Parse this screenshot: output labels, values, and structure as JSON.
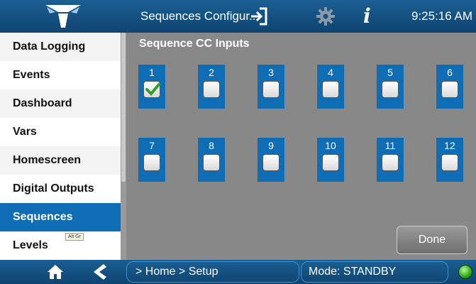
{
  "header": {
    "title": "Sequences Configur...",
    "time": "9:25:16 AM",
    "info_glyph": "i"
  },
  "sidebar": {
    "items": [
      {
        "label": "Data Logging",
        "active": false
      },
      {
        "label": "Events",
        "active": false
      },
      {
        "label": "Dashboard",
        "active": false
      },
      {
        "label": "Vars",
        "active": false
      },
      {
        "label": "Homescreen",
        "active": false
      },
      {
        "label": "Digital Outputs",
        "active": false
      },
      {
        "label": "Sequences",
        "active": true
      },
      {
        "label": "Levels",
        "active": false
      }
    ],
    "keyboard_badge": "Alt Gr"
  },
  "main": {
    "title": "Sequence CC Inputs",
    "inputs": [
      {
        "label": "1",
        "checked": true
      },
      {
        "label": "2",
        "checked": false
      },
      {
        "label": "3",
        "checked": false
      },
      {
        "label": "4",
        "checked": false
      },
      {
        "label": "5",
        "checked": false
      },
      {
        "label": "6",
        "checked": false
      },
      {
        "label": "7",
        "checked": false
      },
      {
        "label": "8",
        "checked": false
      },
      {
        "label": "9",
        "checked": false
      },
      {
        "label": "10",
        "checked": false
      },
      {
        "label": "11",
        "checked": false
      },
      {
        "label": "12",
        "checked": false
      }
    ],
    "done_label": "Done"
  },
  "footer": {
    "breadcrumb": "> Home > Setup",
    "mode": "Mode: STANDBY",
    "status_color": "#2ea51c"
  },
  "colors": {
    "accent": "#0f6db5",
    "bar": "#1a5f93",
    "panel": "#888888"
  }
}
